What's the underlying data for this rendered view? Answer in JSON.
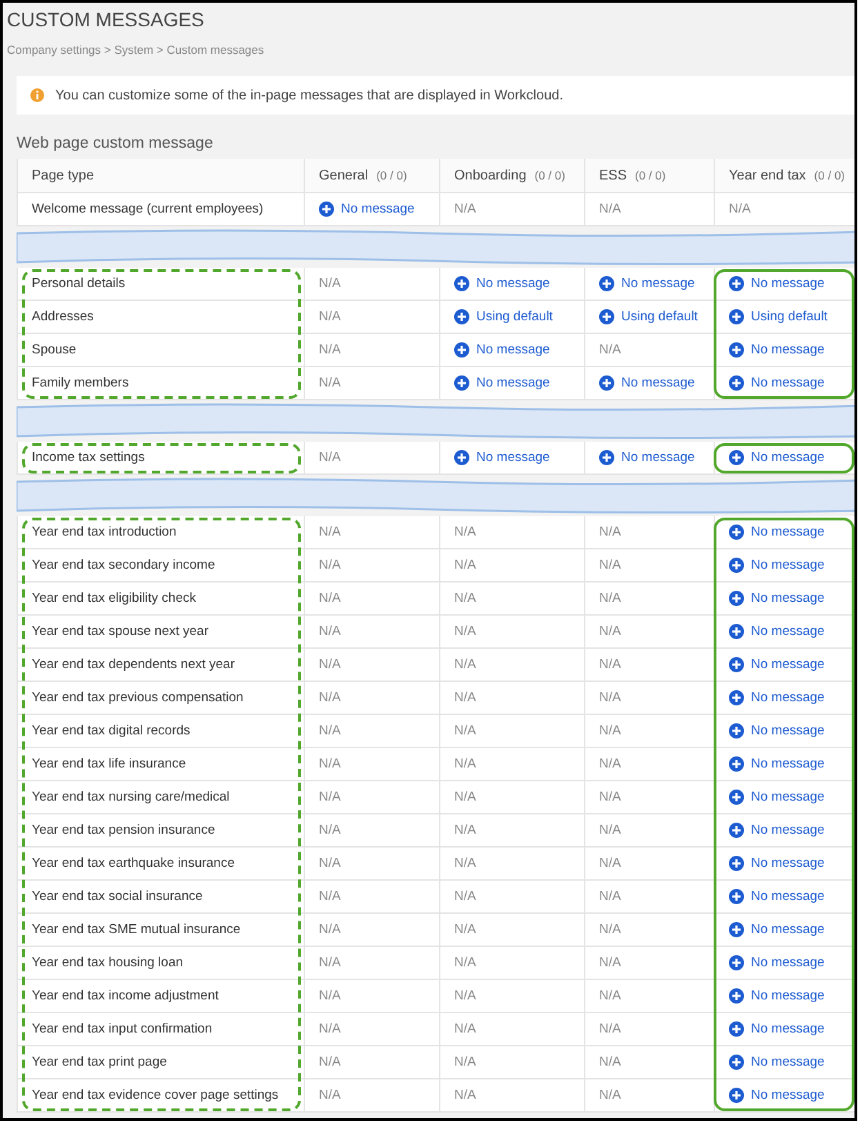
{
  "title": "CUSTOM MESSAGES",
  "breadcrumb": "Company settings > System > Custom messages",
  "info": "You can customize some of the in-page messages that are displayed in Workcloud.",
  "section_title": "Web page custom message",
  "columns": [
    {
      "label": "Page type"
    },
    {
      "label": "General",
      "count": "(0 / 0)"
    },
    {
      "label": "Onboarding",
      "count": "(0 / 0)"
    },
    {
      "label": "ESS",
      "count": "(0 / 0)"
    },
    {
      "label": "Year end tax",
      "count": "(0 / 0)"
    }
  ],
  "sections": [
    {
      "highlighted": false,
      "rows": [
        {
          "page_type": "Welcome message (current employees)",
          "cells": [
            {
              "kind": "link",
              "text": "No message"
            },
            {
              "kind": "na",
              "text": "N/A"
            },
            {
              "kind": "na",
              "text": "N/A"
            },
            {
              "kind": "na",
              "text": "N/A"
            }
          ]
        }
      ]
    },
    {
      "highlighted": true,
      "rows": [
        {
          "page_type": "Personal details",
          "cells": [
            {
              "kind": "na",
              "text": "N/A"
            },
            {
              "kind": "link",
              "text": "No message"
            },
            {
              "kind": "link",
              "text": "No message"
            },
            {
              "kind": "link",
              "text": "No message"
            }
          ]
        },
        {
          "page_type": "Addresses",
          "cells": [
            {
              "kind": "na",
              "text": "N/A"
            },
            {
              "kind": "link",
              "text": "Using default"
            },
            {
              "kind": "link",
              "text": "Using default"
            },
            {
              "kind": "link",
              "text": "Using default"
            }
          ]
        },
        {
          "page_type": "Spouse",
          "cells": [
            {
              "kind": "na",
              "text": "N/A"
            },
            {
              "kind": "link",
              "text": "No message"
            },
            {
              "kind": "na",
              "text": "N/A"
            },
            {
              "kind": "link",
              "text": "No message"
            }
          ]
        },
        {
          "page_type": "Family members",
          "cells": [
            {
              "kind": "na",
              "text": "N/A"
            },
            {
              "kind": "link",
              "text": "No message"
            },
            {
              "kind": "link",
              "text": "No message"
            },
            {
              "kind": "link",
              "text": "No message"
            }
          ]
        }
      ]
    },
    {
      "highlighted": true,
      "rows": [
        {
          "page_type": "Income tax settings",
          "cells": [
            {
              "kind": "na",
              "text": "N/A"
            },
            {
              "kind": "link",
              "text": "No message"
            },
            {
              "kind": "link",
              "text": "No message"
            },
            {
              "kind": "link",
              "text": "No message"
            }
          ]
        }
      ]
    },
    {
      "highlighted": true,
      "rows": [
        {
          "page_type": "Year end tax introduction",
          "cells": [
            {
              "kind": "na",
              "text": "N/A"
            },
            {
              "kind": "na",
              "text": "N/A"
            },
            {
              "kind": "na",
              "text": "N/A"
            },
            {
              "kind": "link",
              "text": "No message"
            }
          ]
        },
        {
          "page_type": "Year end tax secondary income",
          "cells": [
            {
              "kind": "na",
              "text": "N/A"
            },
            {
              "kind": "na",
              "text": "N/A"
            },
            {
              "kind": "na",
              "text": "N/A"
            },
            {
              "kind": "link",
              "text": "No message"
            }
          ]
        },
        {
          "page_type": "Year end tax eligibility check",
          "cells": [
            {
              "kind": "na",
              "text": "N/A"
            },
            {
              "kind": "na",
              "text": "N/A"
            },
            {
              "kind": "na",
              "text": "N/A"
            },
            {
              "kind": "link",
              "text": "No message"
            }
          ]
        },
        {
          "page_type": "Year end tax spouse next year",
          "cells": [
            {
              "kind": "na",
              "text": "N/A"
            },
            {
              "kind": "na",
              "text": "N/A"
            },
            {
              "kind": "na",
              "text": "N/A"
            },
            {
              "kind": "link",
              "text": "No message"
            }
          ]
        },
        {
          "page_type": "Year end tax dependents next year",
          "cells": [
            {
              "kind": "na",
              "text": "N/A"
            },
            {
              "kind": "na",
              "text": "N/A"
            },
            {
              "kind": "na",
              "text": "N/A"
            },
            {
              "kind": "link",
              "text": "No message"
            }
          ]
        },
        {
          "page_type": "Year end tax previous compensation",
          "cells": [
            {
              "kind": "na",
              "text": "N/A"
            },
            {
              "kind": "na",
              "text": "N/A"
            },
            {
              "kind": "na",
              "text": "N/A"
            },
            {
              "kind": "link",
              "text": "No message"
            }
          ]
        },
        {
          "page_type": "Year end tax digital records",
          "cells": [
            {
              "kind": "na",
              "text": "N/A"
            },
            {
              "kind": "na",
              "text": "N/A"
            },
            {
              "kind": "na",
              "text": "N/A"
            },
            {
              "kind": "link",
              "text": "No message"
            }
          ]
        },
        {
          "page_type": "Year end tax life insurance",
          "cells": [
            {
              "kind": "na",
              "text": "N/A"
            },
            {
              "kind": "na",
              "text": "N/A"
            },
            {
              "kind": "na",
              "text": "N/A"
            },
            {
              "kind": "link",
              "text": "No message"
            }
          ]
        },
        {
          "page_type": "Year end tax nursing care/medical",
          "cells": [
            {
              "kind": "na",
              "text": "N/A"
            },
            {
              "kind": "na",
              "text": "N/A"
            },
            {
              "kind": "na",
              "text": "N/A"
            },
            {
              "kind": "link",
              "text": "No message"
            }
          ]
        },
        {
          "page_type": "Year end tax pension insurance",
          "cells": [
            {
              "kind": "na",
              "text": "N/A"
            },
            {
              "kind": "na",
              "text": "N/A"
            },
            {
              "kind": "na",
              "text": "N/A"
            },
            {
              "kind": "link",
              "text": "No message"
            }
          ]
        },
        {
          "page_type": "Year end tax earthquake insurance",
          "cells": [
            {
              "kind": "na",
              "text": "N/A"
            },
            {
              "kind": "na",
              "text": "N/A"
            },
            {
              "kind": "na",
              "text": "N/A"
            },
            {
              "kind": "link",
              "text": "No message"
            }
          ]
        },
        {
          "page_type": "Year end tax social insurance",
          "cells": [
            {
              "kind": "na",
              "text": "N/A"
            },
            {
              "kind": "na",
              "text": "N/A"
            },
            {
              "kind": "na",
              "text": "N/A"
            },
            {
              "kind": "link",
              "text": "No message"
            }
          ]
        },
        {
          "page_type": "Year end tax SME mutual insurance",
          "cells": [
            {
              "kind": "na",
              "text": "N/A"
            },
            {
              "kind": "na",
              "text": "N/A"
            },
            {
              "kind": "na",
              "text": "N/A"
            },
            {
              "kind": "link",
              "text": "No message"
            }
          ]
        },
        {
          "page_type": "Year end tax housing loan",
          "cells": [
            {
              "kind": "na",
              "text": "N/A"
            },
            {
              "kind": "na",
              "text": "N/A"
            },
            {
              "kind": "na",
              "text": "N/A"
            },
            {
              "kind": "link",
              "text": "No message"
            }
          ]
        },
        {
          "page_type": "Year end tax income adjustment",
          "cells": [
            {
              "kind": "na",
              "text": "N/A"
            },
            {
              "kind": "na",
              "text": "N/A"
            },
            {
              "kind": "na",
              "text": "N/A"
            },
            {
              "kind": "link",
              "text": "No message"
            }
          ]
        },
        {
          "page_type": "Year end tax input confirmation",
          "cells": [
            {
              "kind": "na",
              "text": "N/A"
            },
            {
              "kind": "na",
              "text": "N/A"
            },
            {
              "kind": "na",
              "text": "N/A"
            },
            {
              "kind": "link",
              "text": "No message"
            }
          ]
        },
        {
          "page_type": "Year end tax print page",
          "cells": [
            {
              "kind": "na",
              "text": "N/A"
            },
            {
              "kind": "na",
              "text": "N/A"
            },
            {
              "kind": "na",
              "text": "N/A"
            },
            {
              "kind": "link",
              "text": "No message"
            }
          ]
        },
        {
          "page_type": "Year end tax evidence cover page settings",
          "cells": [
            {
              "kind": "na",
              "text": "N/A"
            },
            {
              "kind": "na",
              "text": "N/A"
            },
            {
              "kind": "na",
              "text": "N/A"
            },
            {
              "kind": "link",
              "text": "No message"
            }
          ]
        }
      ]
    }
  ]
}
